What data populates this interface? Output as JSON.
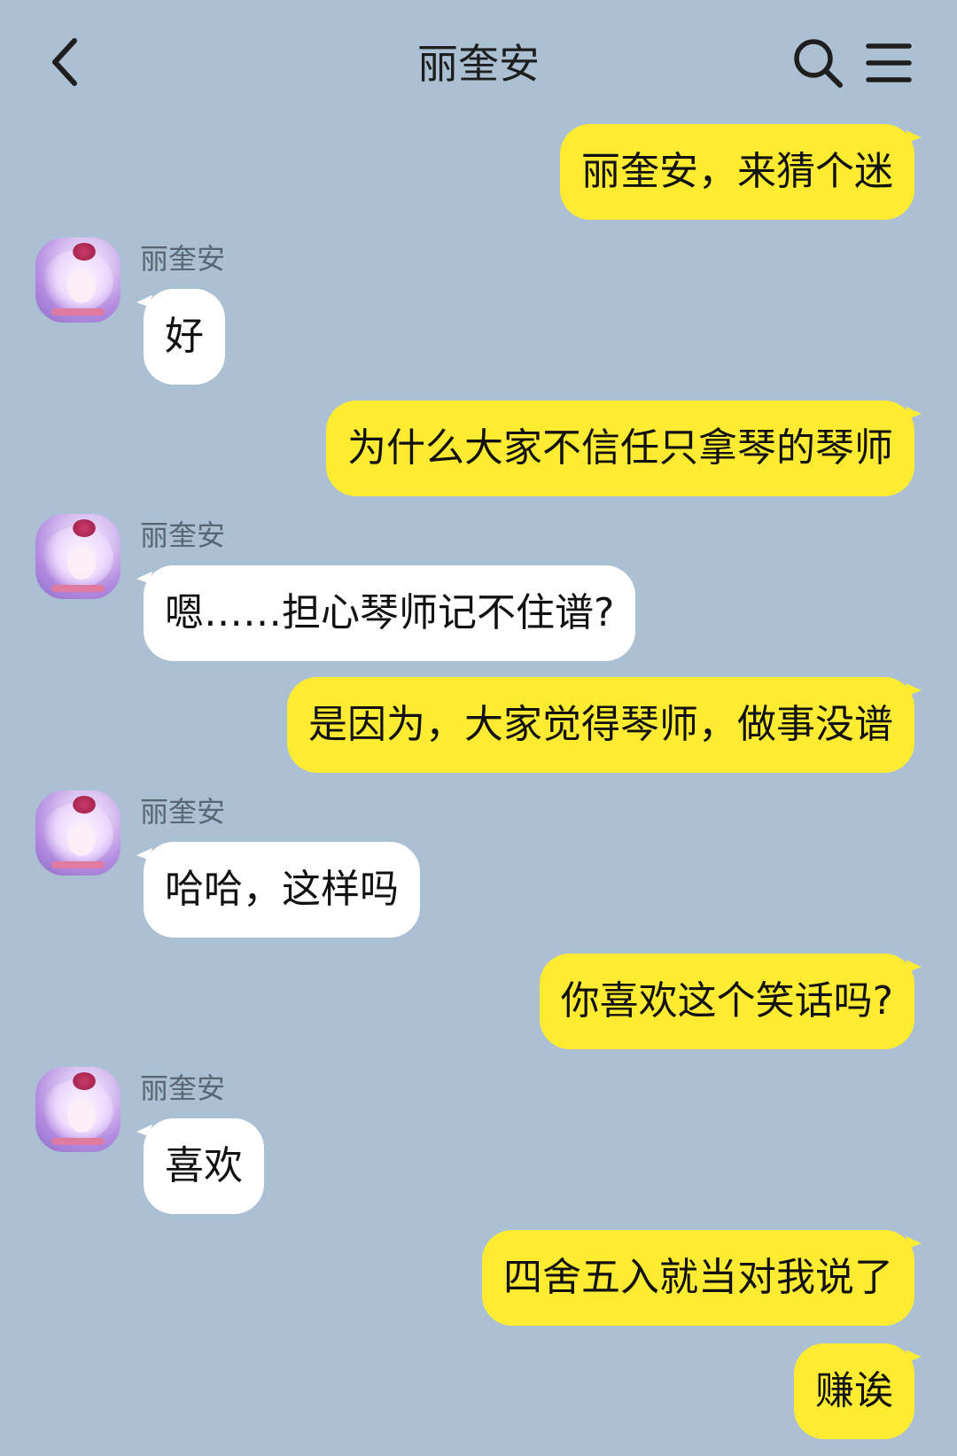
{
  "header": {
    "title": "丽奎安",
    "back_icon": "chevron-left-icon",
    "search_icon": "search-icon",
    "menu_icon": "hamburger-menu-icon"
  },
  "colors": {
    "background": "#abc1d3",
    "outgoing_bubble": "#ffec32",
    "incoming_bubble": "#ffffff"
  },
  "messages": [
    {
      "direction": "out",
      "text": "丽奎安，来猜个迷"
    },
    {
      "direction": "in",
      "sender": "丽奎安",
      "text": "好"
    },
    {
      "direction": "out",
      "text": "为什么大家不信任只拿琴的琴师"
    },
    {
      "direction": "in",
      "sender": "丽奎安",
      "text": "嗯……担心琴师记不住谱?"
    },
    {
      "direction": "out",
      "text": "是因为，大家觉得琴师，做事没谱"
    },
    {
      "direction": "in",
      "sender": "丽奎安",
      "text": "哈哈，这样吗"
    },
    {
      "direction": "out",
      "text": "你喜欢这个笑话吗?"
    },
    {
      "direction": "in",
      "sender": "丽奎安",
      "text": "喜欢"
    },
    {
      "direction": "out",
      "text": "四舍五入就当对我说了"
    },
    {
      "direction": "out",
      "text": "赚诶"
    }
  ]
}
